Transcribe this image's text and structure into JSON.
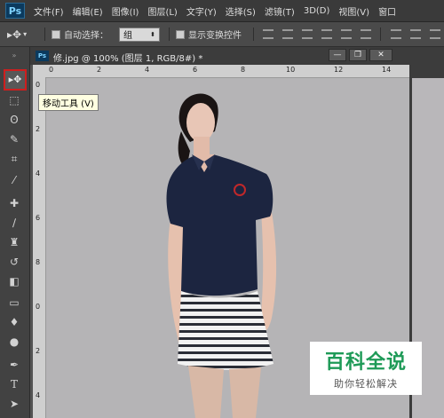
{
  "app": {
    "logo": "Ps"
  },
  "menu": [
    "文件(F)",
    "编辑(E)",
    "图像(I)",
    "图层(L)",
    "文字(Y)",
    "选择(S)",
    "滤镜(T)",
    "3D(D)",
    "视图(V)",
    "窗口"
  ],
  "options": {
    "auto_select_label": "自动选择：",
    "auto_select_value": "组",
    "show_transform_label": "显示变换控件"
  },
  "document": {
    "ps_badge": "Ps",
    "title": "修.jpg @ 100% (图层 1, RGB/8#) *"
  },
  "window_controls": {
    "minimize": "—",
    "restore": "❐",
    "close": "✕"
  },
  "toolbar": {
    "tooltip": "移动工具 (V)",
    "tools": [
      "move-tool",
      "marquee-tool",
      "lasso-tool",
      "quick-select-tool",
      "crop-tool",
      "eyedropper-tool",
      "healing-tool",
      "brush-tool",
      "stamp-tool",
      "history-brush-tool",
      "eraser-tool",
      "gradient-tool",
      "blur-tool",
      "dodge-tool",
      "pen-tool",
      "type-tool",
      "path-select-tool"
    ]
  },
  "ruler_top": [
    "0",
    "2",
    "4",
    "6",
    "8",
    "10",
    "12",
    "14"
  ],
  "ruler_left": [
    "0",
    "2",
    "4",
    "6",
    "8",
    "0",
    "2",
    "4"
  ],
  "watermark": {
    "title": "百科全说",
    "subtitle": "助你轻松解决"
  },
  "colors": {
    "menubar": "#3a3a3a",
    "highlight": "#cf1e1e",
    "shirt": "#1c2540",
    "logo_red": "#c0282a",
    "watermark_green": "#1e9a57"
  }
}
